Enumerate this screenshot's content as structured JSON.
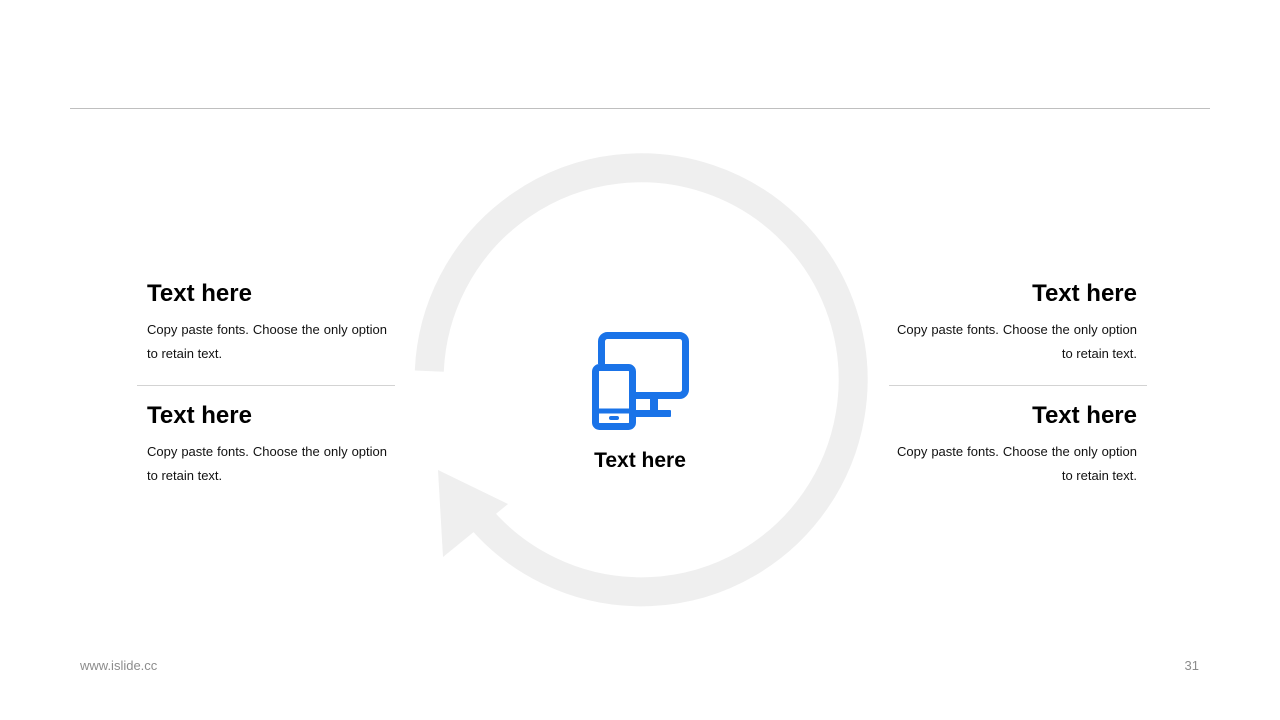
{
  "colors": {
    "accent": "#1a73e8",
    "cycle_arrow": "#efefef",
    "rule": "#bfbfbf",
    "footer_text": "#8c8c8c"
  },
  "center": {
    "icon": "devices-icon",
    "label": "Text here"
  },
  "left_items": [
    {
      "title": "Text here",
      "body": "Copy paste fonts. Choose the only option to retain text."
    },
    {
      "title": "Text here",
      "body": "Copy paste fonts. Choose the only option to retain text."
    }
  ],
  "right_items": [
    {
      "title": "Text here",
      "body": "Copy paste fonts. Choose the only option to retain text."
    },
    {
      "title": "Text here",
      "body": "Copy paste fonts. Choose the only option to retain text."
    }
  ],
  "footer": {
    "website": "www.islide.cc",
    "page_number": "31"
  }
}
